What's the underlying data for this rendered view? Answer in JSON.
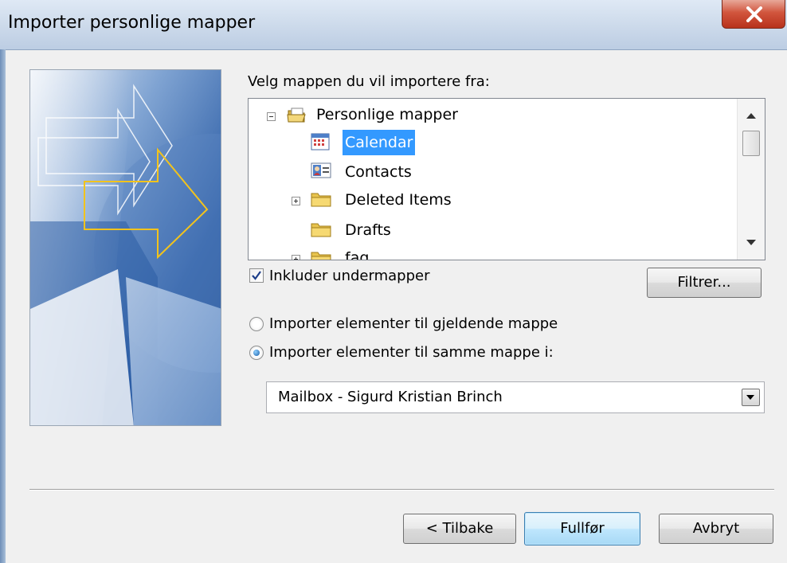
{
  "window": {
    "title": "Importer personlige mapper"
  },
  "folder_picker": {
    "label": "Velg mappen du vil importere fra:",
    "items": [
      {
        "label": "Personlige mapper",
        "icon": "personal-folders-icon",
        "expanded": true,
        "selected": false
      },
      {
        "label": "Calendar",
        "icon": "calendar-icon",
        "selected": true
      },
      {
        "label": "Contacts",
        "icon": "contacts-icon",
        "selected": false
      },
      {
        "label": "Deleted Items",
        "icon": "folder-icon",
        "collapsed": true,
        "selected": false
      },
      {
        "label": "Drafts",
        "icon": "folder-icon",
        "selected": false
      },
      {
        "label": "fag",
        "icon": "folder-icon",
        "partially_visible": true,
        "selected": false
      }
    ]
  },
  "options": {
    "include_subfolders_label": "Inkluder undermapper",
    "include_subfolders_checked": true,
    "filter_button": "Filtrer...",
    "radio_current_label": "Importer elementer til gjeldende mappe",
    "radio_same_label": "Importer elementer til samme mappe i:",
    "selected_radio": "same"
  },
  "target_mailbox": {
    "value": "Mailbox - Sigurd Kristian Brinch"
  },
  "buttons": {
    "back": "< Tilbake",
    "finish": "Fullfør",
    "cancel": "Avbryt"
  },
  "colors": {
    "selection": "#3399ff",
    "banner_blue": "#1f4f95",
    "arrow_yellow": "#f2c31c",
    "close_red": "#c9402a"
  }
}
